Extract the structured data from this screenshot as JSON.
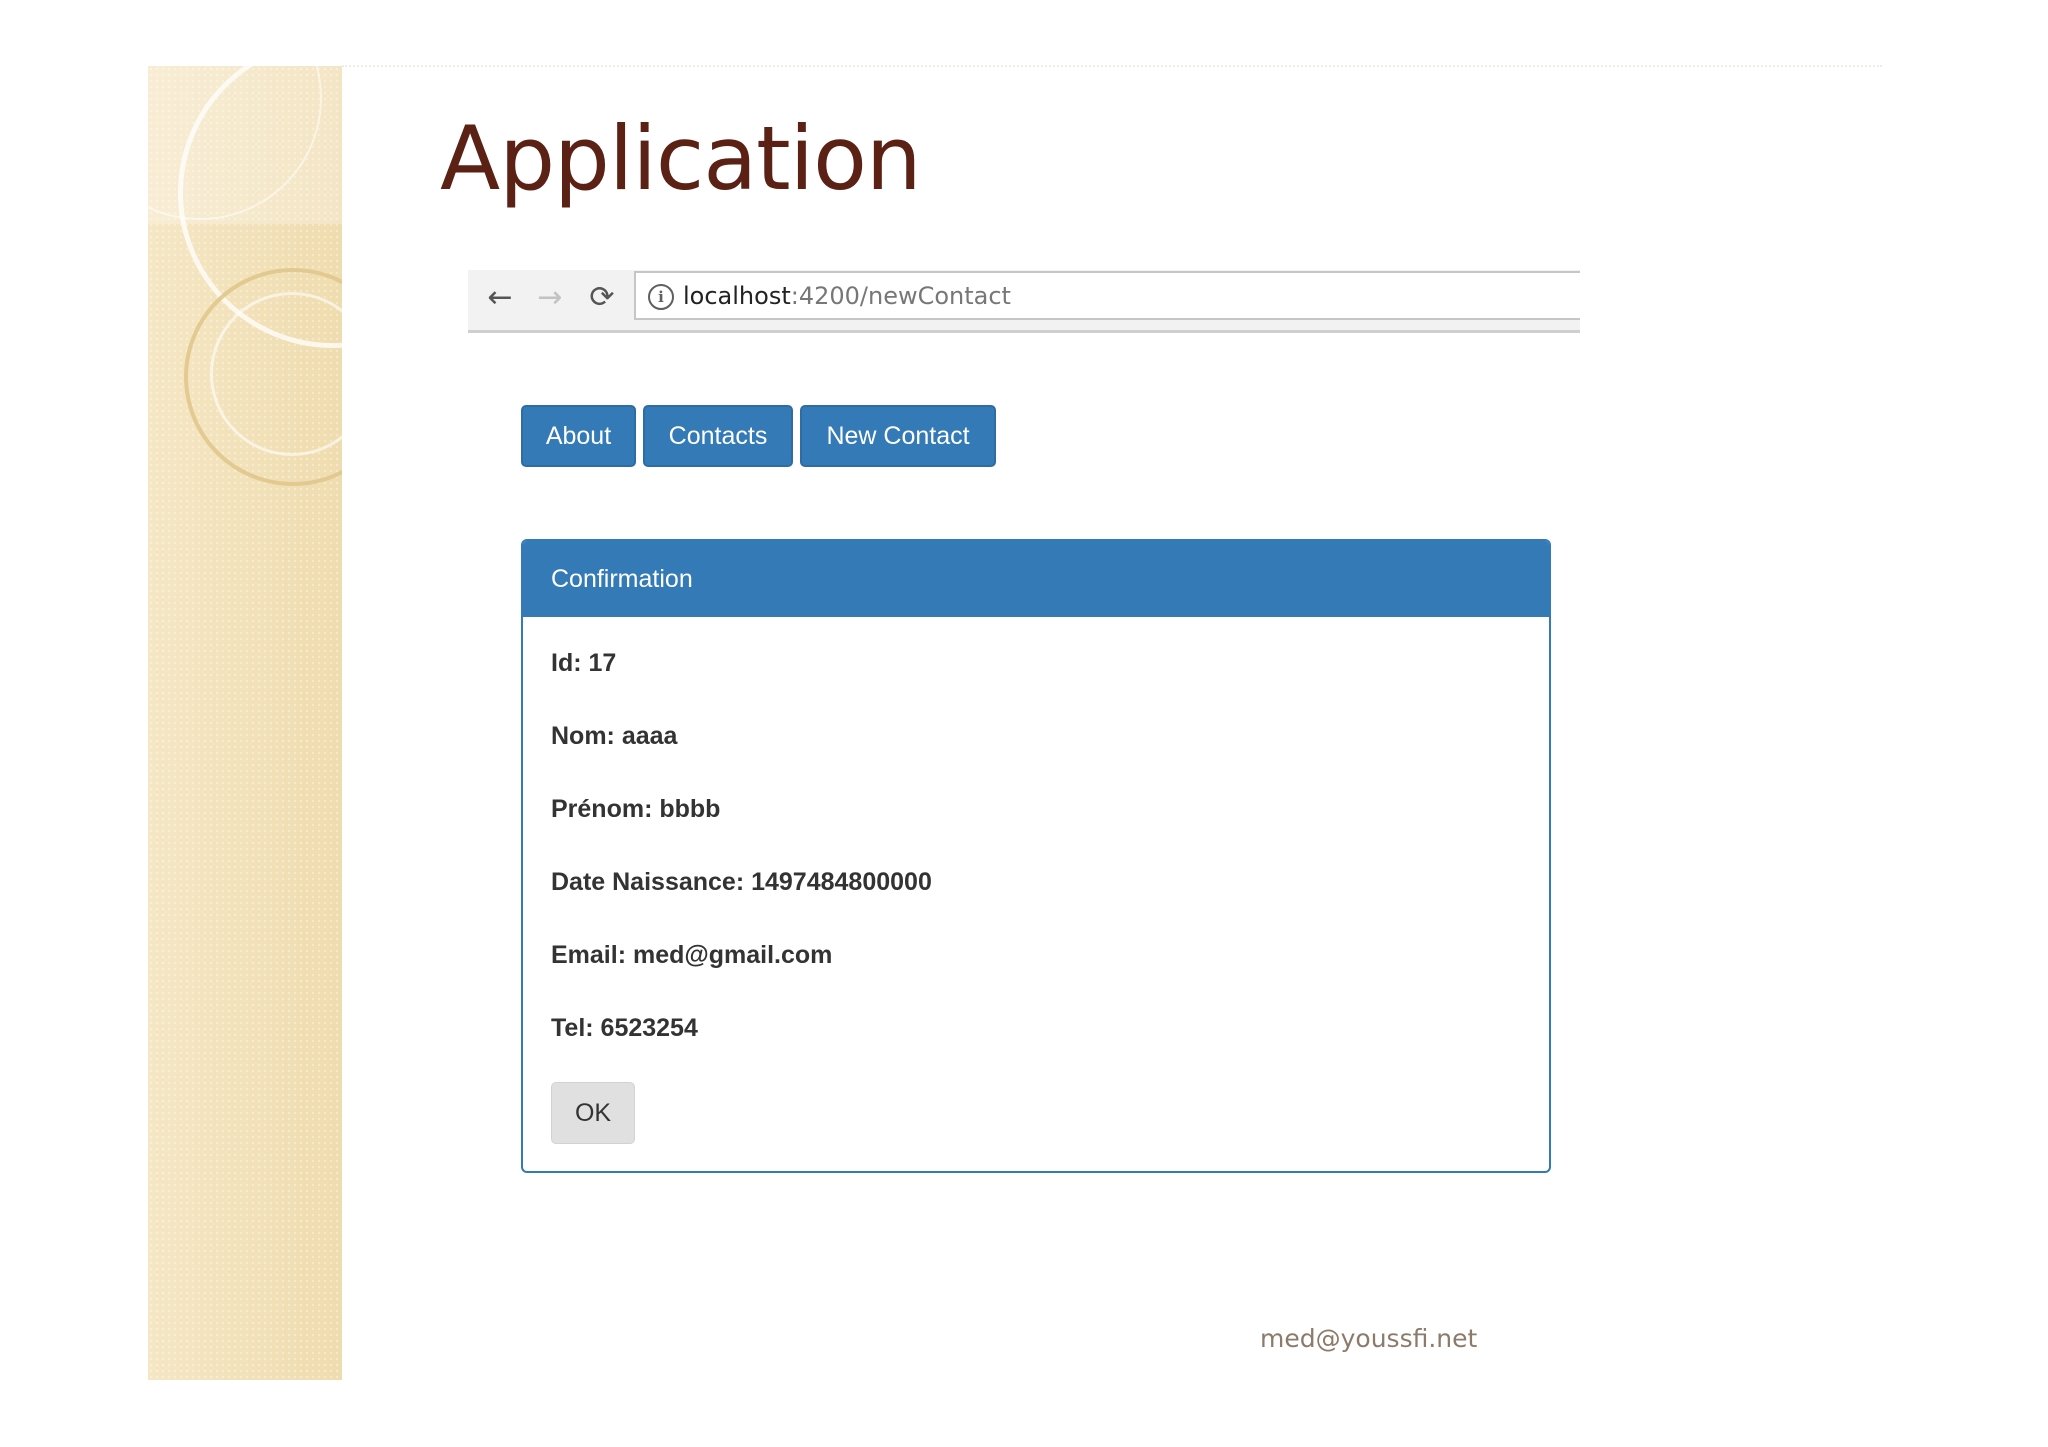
{
  "slide": {
    "title": "Application",
    "footer_email": "med@youssfi.net"
  },
  "browser": {
    "back_icon": "arrow-left-icon",
    "forward_icon": "arrow-right-icon",
    "reload_icon": "reload-icon",
    "info_icon": "info-icon",
    "url_host": "localhost",
    "url_path": ":4200/newContact"
  },
  "nav": {
    "buttons": [
      "About",
      "Contacts",
      "New Contact"
    ]
  },
  "panel": {
    "title": "Confirmation",
    "fields": [
      "Id: 17",
      "Nom: aaaa",
      "Prénom: bbbb",
      "Date Naissance: 1497484800000",
      "Email: med@gmail.com",
      "Tel: 6523254"
    ],
    "ok_label": "OK"
  },
  "colors": {
    "primary": "#337ab7",
    "title": "#5a2114",
    "band": "#f3e4bf",
    "footer_text": "#8c7b6b",
    "ok_button": "#e0e0e0"
  }
}
